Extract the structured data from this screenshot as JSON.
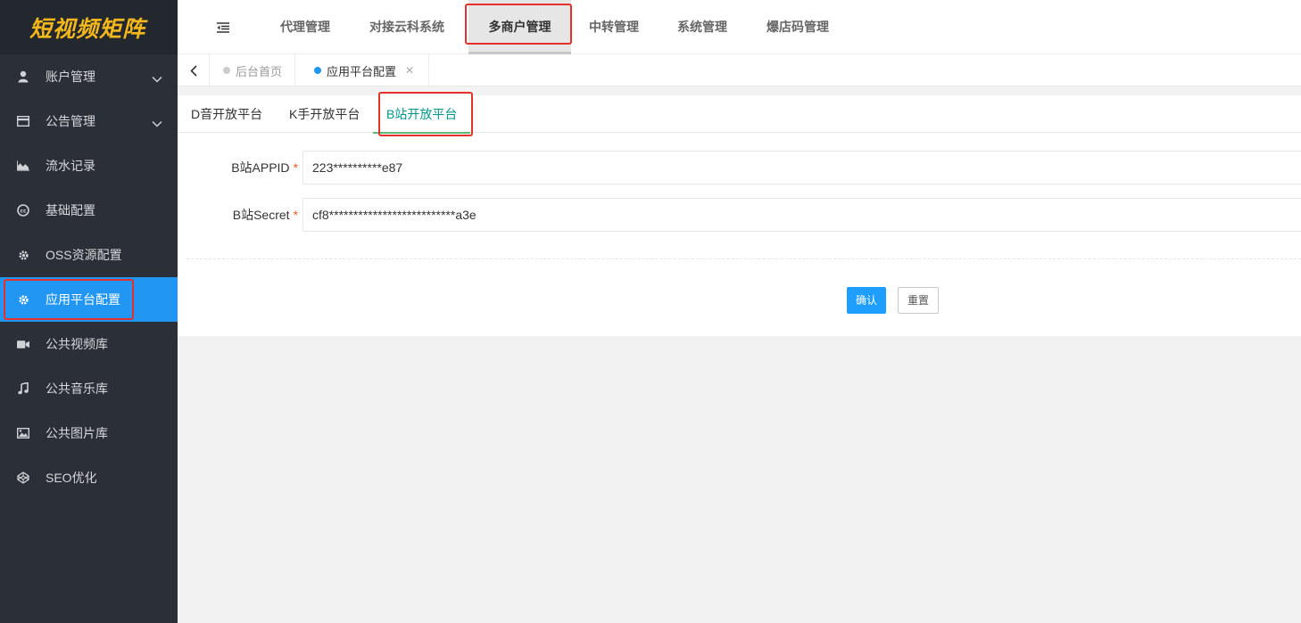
{
  "app": {
    "logo": "短视频矩阵"
  },
  "sidebar": {
    "items": [
      {
        "label": "账户管理",
        "icon": "user-icon",
        "has_arrow": true
      },
      {
        "label": "公告管理",
        "icon": "card-icon",
        "has_arrow": true
      },
      {
        "label": "流水记录",
        "icon": "area-chart-icon"
      },
      {
        "label": "基础配置",
        "icon": "cc-icon"
      },
      {
        "label": "OSS资源配置",
        "icon": "gear-icon"
      },
      {
        "label": "应用平台配置",
        "icon": "gear-icon",
        "active": true
      },
      {
        "label": "公共视频库",
        "icon": "video-camera-icon"
      },
      {
        "label": "公共音乐库",
        "icon": "music-note-icon"
      },
      {
        "label": "公共图片库",
        "icon": "image-icon"
      },
      {
        "label": "SEO优化",
        "icon": "codepen-icon"
      }
    ]
  },
  "topnav": {
    "items": [
      "代理管理",
      "对接云科系统",
      "多商户管理",
      "中转管理",
      "系统管理",
      "爆店码管理"
    ],
    "active": "多商户管理"
  },
  "tabs": [
    {
      "label": "后台首页"
    },
    {
      "label": "应用平台配置",
      "current": true
    }
  ],
  "subtabs": [
    "D音开放平台",
    "K手开放平台",
    "B站开放平台"
  ],
  "form": {
    "appid_label": "B站APPID",
    "appid_value": "223**********e87",
    "secret_label": "B站Secret",
    "secret_value": "cf8**************************a3e",
    "required_mark": "*"
  },
  "buttons": {
    "confirm": "确认",
    "reset": "重置"
  },
  "colors": {
    "sidebar_bg": "#2a2f38",
    "active_blue": "#2196f3",
    "tab_active": "#009688",
    "highlight_red": "#e5312e",
    "logo": "#f5b81c"
  }
}
